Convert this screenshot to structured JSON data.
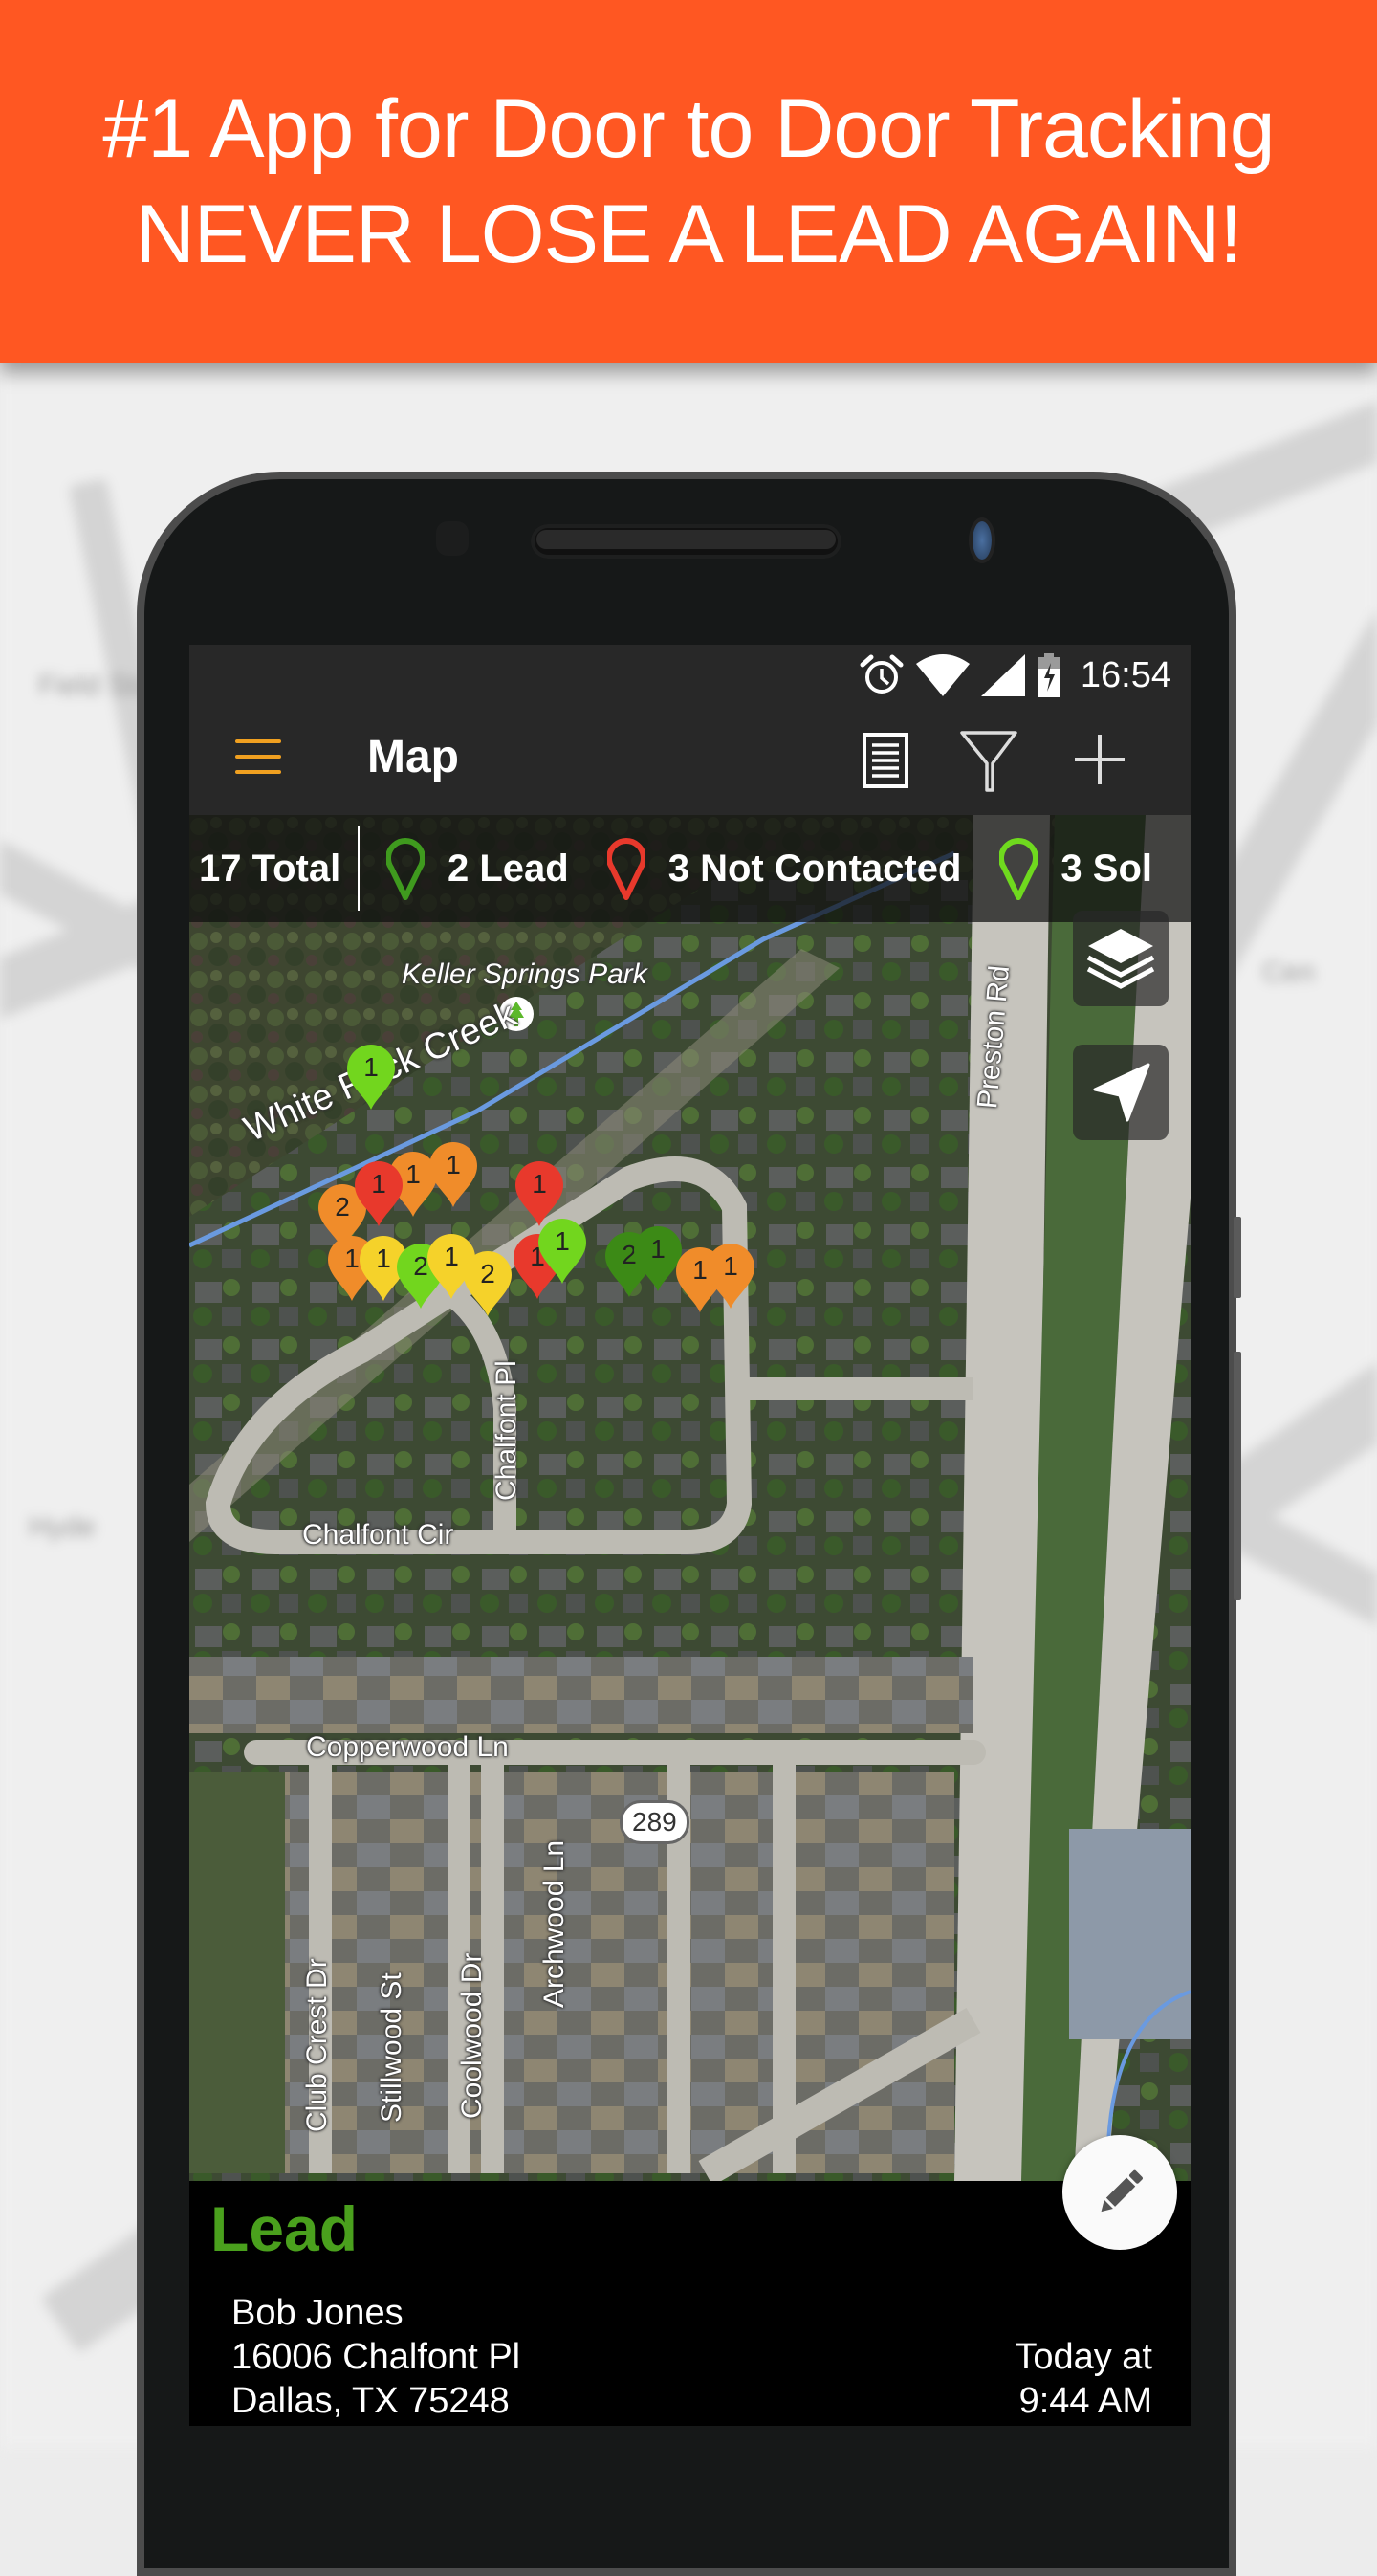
{
  "banner": {
    "line1": "#1 App for Door to Door Tracking",
    "line2": "NEVER LOSE A LEAD AGAIN!",
    "color": "#ff5722"
  },
  "status_bar": {
    "icons": [
      "alarm-icon",
      "wifi-icon",
      "cell-signal-icon",
      "battery-charging-icon"
    ],
    "time": "16:54"
  },
  "toolbar": {
    "menu_icon": "hamburger-menu-icon",
    "title": "Map",
    "actions": [
      {
        "icon": "list-view-icon",
        "label": "List"
      },
      {
        "icon": "filter-icon",
        "label": "Filter"
      },
      {
        "icon": "plus-icon",
        "label": "Add"
      }
    ]
  },
  "legend": {
    "total": "17 Total",
    "items": [
      {
        "label": "2 Lead",
        "color": "#3f9a1e"
      },
      {
        "label": "3 Not Contacted",
        "color": "#e8392c"
      },
      {
        "label": "3 Sol",
        "color": "#6fd91e"
      }
    ]
  },
  "map": {
    "labels": {
      "park": "Keller Springs Park",
      "creek": "White Rock Creek",
      "preston": "Preston Rd",
      "highway": "289",
      "chalfont_pl": "Chalfont Pl",
      "chalfont_cir": "Chalfont Cir",
      "copperwood": "Copperwood Ln",
      "club_crest": "Club Crest Dr",
      "stillwood": "Stillwood St",
      "coolwood": "Coolwood Dr",
      "archwood": "Archwood Ln"
    },
    "layers_button": "layers-icon",
    "location_button": "my-location-icon",
    "pins": [
      {
        "count": "1",
        "color": "#72d61e"
      },
      {
        "count": "1",
        "color": "#f08c2a"
      },
      {
        "count": "1",
        "color": "#f08c2a"
      },
      {
        "count": "2",
        "color": "#f08c2a"
      },
      {
        "count": "1",
        "color": "#e8392c"
      },
      {
        "count": "1",
        "color": "#e8392c"
      },
      {
        "count": "1",
        "color": "#f08c2a"
      },
      {
        "count": "1",
        "color": "#f5d22a"
      },
      {
        "count": "2",
        "color": "#72d61e"
      },
      {
        "count": "1",
        "color": "#f5d22a"
      },
      {
        "count": "2",
        "color": "#f5d22a"
      },
      {
        "count": "1",
        "color": "#e8392c"
      },
      {
        "count": "1",
        "color": "#72d61e"
      },
      {
        "count": "2",
        "color": "#3c8a16"
      },
      {
        "count": "1",
        "color": "#3c8a16"
      },
      {
        "count": "1",
        "color": "#f08c2a"
      },
      {
        "count": "1",
        "color": "#f08c2a"
      }
    ]
  },
  "info_panel": {
    "status": "Lead",
    "status_color": "#4aa01d",
    "name": "Bob Jones",
    "address1": "16006 Chalfont Pl",
    "address2": "Dallas, TX 75248",
    "time_line1": "Today at",
    "time_line2": "9:44 AM",
    "edit_icon": "pencil-icon"
  }
}
